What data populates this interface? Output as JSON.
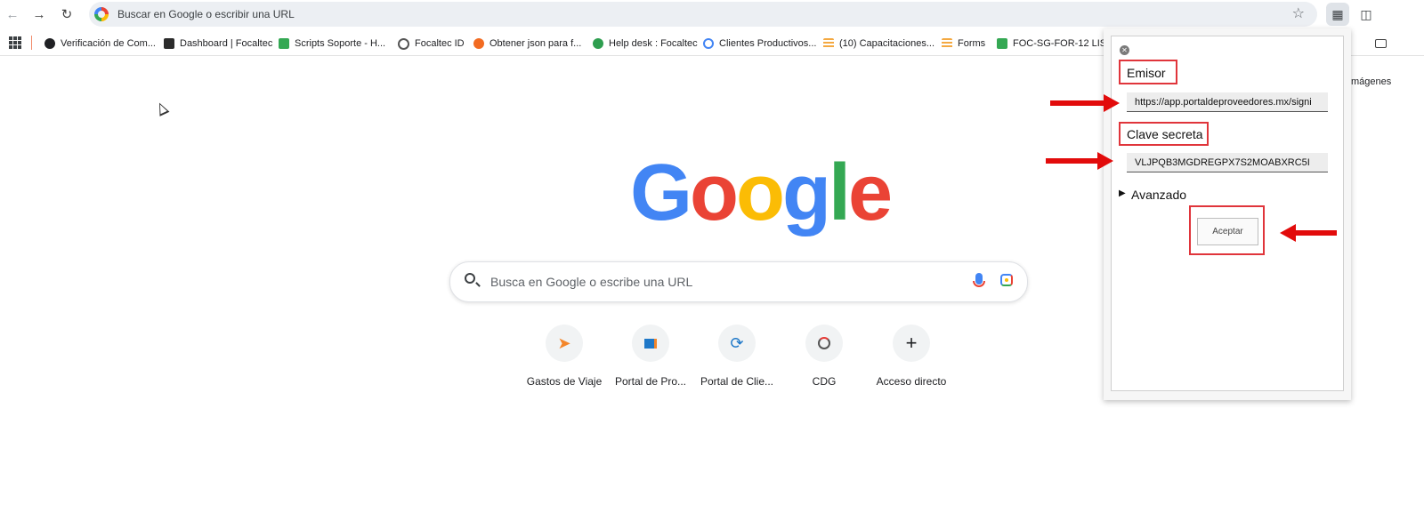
{
  "browser": {
    "omnibox_text": "Buscar en Google o escribir una URL"
  },
  "bookmarks": [
    {
      "label": "Verificación de Com...",
      "icon": "globe-icon",
      "color": "#202124"
    },
    {
      "label": "Dashboard | Focaltec",
      "icon": "d-logo-icon",
      "color": "#2b2b2b"
    },
    {
      "label": "Scripts Soporte - H...",
      "icon": "sheets-icon",
      "color": "#34a853"
    },
    {
      "label": "Focaltec ID",
      "icon": "focaltec-id-icon",
      "color": "#555555"
    },
    {
      "label": "Obtener json para f...",
      "icon": "orange-logo-icon",
      "color": "#f26b21"
    },
    {
      "label": "Help desk : Focaltec",
      "icon": "helpdesk-icon",
      "color": "#2e9e4f"
    },
    {
      "label": "Clientes Productivos...",
      "icon": "location-icon",
      "color": "#4285f4"
    },
    {
      "label": "(10) Capacitaciones...",
      "icon": "forms-icon",
      "color": "#f4a942"
    },
    {
      "label": "Forms",
      "icon": "forms-icon",
      "color": "#f4a942"
    },
    {
      "label": "FOC-SG-FOR-12 LIS...",
      "icon": "sheets-icon",
      "color": "#34a853"
    }
  ],
  "page": {
    "partial_text": "mágenes",
    "logo_letters": [
      {
        "char": "G",
        "color": "#4285f4"
      },
      {
        "char": "o",
        "color": "#ea4335"
      },
      {
        "char": "o",
        "color": "#fbbc05"
      },
      {
        "char": "g",
        "color": "#4285f4"
      },
      {
        "char": "l",
        "color": "#34a853"
      },
      {
        "char": "e",
        "color": "#ea4335"
      }
    ],
    "search_placeholder": "Busca en Google o escribe una URL",
    "shortcuts": [
      {
        "label": "Gastos de Viaje",
        "icon": "paper-plane-icon"
      },
      {
        "label": "Portal de Pro...",
        "icon": "cube-icon"
      },
      {
        "label": "Portal de Clie...",
        "icon": "refresh-icon"
      },
      {
        "label": "CDG",
        "icon": "gauge-icon"
      },
      {
        "label": "Acceso directo",
        "icon": "plus-icon"
      }
    ]
  },
  "popup": {
    "emisor_label": "Emisor",
    "emisor_value": "https://app.portaldeproveedores.mx/signi",
    "clave_label": "Clave secreta",
    "clave_value": "VLJPQB3MGDREGPX7S2MOABXRC5I",
    "advanced_label": "Avanzado",
    "accept_label": "Aceptar"
  }
}
